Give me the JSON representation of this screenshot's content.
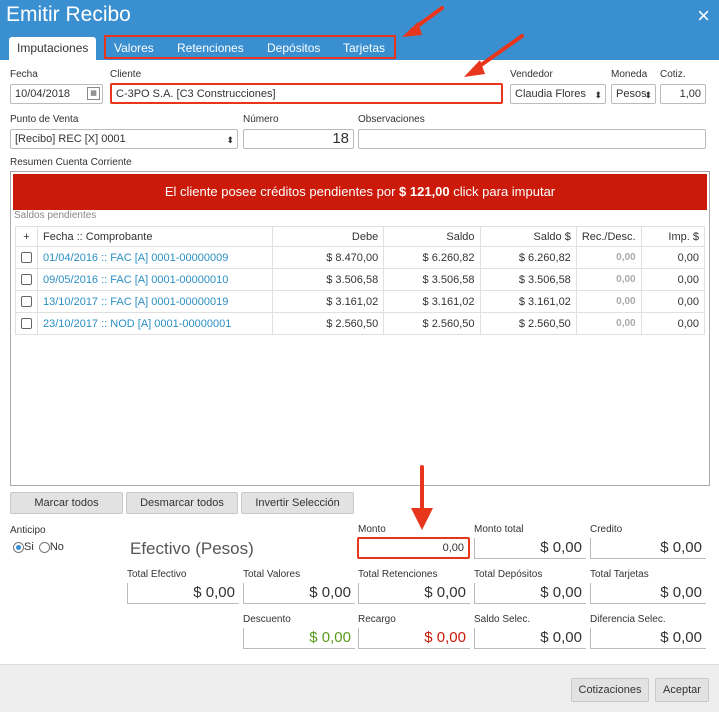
{
  "window": {
    "title": "Emitir Recibo",
    "close_icon": "×"
  },
  "tabs": [
    {
      "label": "Imputaciones"
    },
    {
      "label": "Valores"
    },
    {
      "label": "Retenciones"
    },
    {
      "label": "Depósitos"
    },
    {
      "label": "Tarjetas"
    }
  ],
  "header": {
    "fecha_label": "Fecha",
    "fecha_value": "10/04/2018",
    "cliente_label": "Cliente",
    "cliente_value": "C-3PO S.A. [C3 Construcciones]",
    "vendedor_label": "Vendedor",
    "vendedor_value": "Claudia Flores",
    "moneda_label": "Moneda",
    "moneda_value": "Pesos",
    "cotiz_label": "Cotiz.",
    "cotiz_value": "1,00",
    "punto_label": "Punto de Venta",
    "punto_value": "[Recibo] REC [X] 0001",
    "numero_label": "Número",
    "numero_value": "18",
    "obs_label": "Observaciones",
    "obs_value": ""
  },
  "resumen": {
    "label": "Resumen Cuenta Corriente",
    "banner_pre": "El cliente posee créditos pendientes por",
    "banner_amount": "$ 121,00",
    "banner_post": "click para imputar",
    "saldos_label": "Saldos pendientes",
    "columns": [
      "+",
      "Fecha :: Comprobante",
      "Debe",
      "Saldo",
      "Saldo $",
      "Rec./Desc.",
      "Imp. $"
    ],
    "rows": [
      {
        "comprobante": "01/04/2016 :: FAC [A] 0001-00000009",
        "debe": "$ 8.470,00",
        "saldo": "$ 6.260,82",
        "saldo_ars": "$ 6.260,82",
        "rec": "0,00",
        "imp": "0,00"
      },
      {
        "comprobante": "09/05/2016 :: FAC [A] 0001-00000010",
        "debe": "$ 3.506,58",
        "saldo": "$ 3.506,58",
        "saldo_ars": "$ 3.506,58",
        "rec": "0,00",
        "imp": "0,00"
      },
      {
        "comprobante": "13/10/2017 :: FAC [A] 0001-00000019",
        "debe": "$ 3.161,02",
        "saldo": "$ 3.161,02",
        "saldo_ars": "$ 3.161,02",
        "rec": "0,00",
        "imp": "0,00"
      },
      {
        "comprobante": "23/10/2017 :: NOD [A] 0001-00000001",
        "debe": "$ 2.560,50",
        "saldo": "$ 2.560,50",
        "saldo_ars": "$ 2.560,50",
        "rec": "0,00",
        "imp": "0,00"
      }
    ]
  },
  "actions": {
    "marcar": "Marcar todos",
    "desmarcar": "Desmarcar todos",
    "invertir": "Invertir Selección"
  },
  "totals": {
    "anticipo_label": "Anticipo",
    "si_label": "Si",
    "no_label": "No",
    "efectivo_label": "Efectivo (Pesos)",
    "monto_label": "Monto",
    "monto_value": "0,00",
    "monto_total_label": "Monto total",
    "monto_total_value": "$ 0,00",
    "credito_label": "Credito",
    "credito_value": "$ 0,00",
    "total_efectivo_label": "Total Efectivo",
    "total_efectivo_value": "$ 0,00",
    "total_valores_label": "Total Valores",
    "total_valores_value": "$ 0,00",
    "total_retenciones_label": "Total Retenciones",
    "total_retenciones_value": "$ 0,00",
    "total_depositos_label": "Total Depósitos",
    "total_depositos_value": "$ 0,00",
    "total_tarjetas_label": "Total Tarjetas",
    "total_tarjetas_value": "$ 0,00",
    "descuento_label": "Descuento",
    "descuento_value": "$ 0,00",
    "recargo_label": "Recargo",
    "recargo_value": "$ 0,00",
    "saldo_selec_label": "Saldo Selec.",
    "saldo_selec_value": "$ 0,00",
    "diferencia_label": "Diferencia Selec.",
    "diferencia_value": "$ 0,00"
  },
  "footer": {
    "cotizaciones": "Cotizaciones",
    "aceptar": "Aceptar"
  },
  "colors": {
    "accent": "#3a8fd0",
    "alert": "#cc1a0a",
    "highlight": "#e8361c",
    "positive": "#5a9a1a",
    "negative": "#cc1a0a"
  }
}
